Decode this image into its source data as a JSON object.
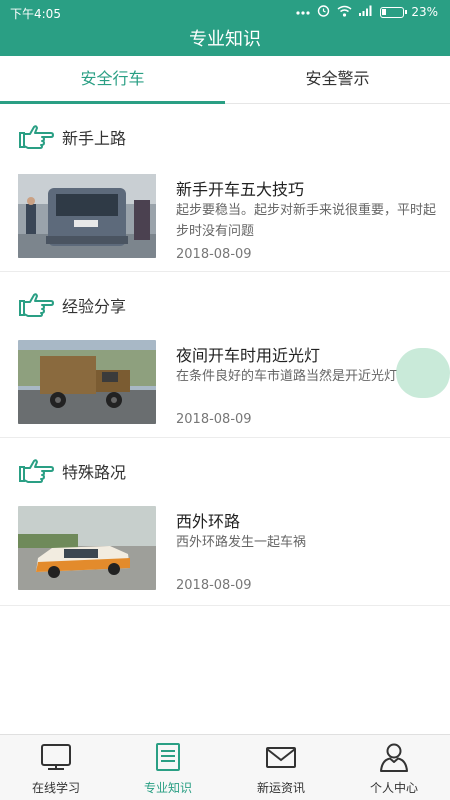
{
  "status_bar": {
    "time": "下午4:05",
    "battery": "23%"
  },
  "header": {
    "title": "专业知识"
  },
  "tabs": [
    {
      "label": "安全行车",
      "active": true
    },
    {
      "label": "安全警示",
      "active": false
    }
  ],
  "sections": [
    {
      "heading": "新手上路",
      "item": {
        "title": "新手开车五大技巧",
        "desc": "起步要稳当。起步对新手来说很重要，平时起步时没有问题",
        "date": "2018-08-09"
      }
    },
    {
      "heading": "经验分享",
      "item": {
        "title": "夜间开车时用近光灯",
        "desc": "在条件良好的车市道路当然是开近光灯",
        "date": "2018-08-09"
      }
    },
    {
      "heading": "特殊路况",
      "item": {
        "title": "西外环路",
        "desc": "西外环路发生一起车祸",
        "date": "2018-08-09"
      }
    }
  ],
  "bottom_nav": [
    {
      "label": "在线学习",
      "icon": "monitor-icon"
    },
    {
      "label": "专业知识",
      "icon": "document-icon",
      "active": true
    },
    {
      "label": "新运资讯",
      "icon": "mail-icon"
    },
    {
      "label": "个人中心",
      "icon": "person-icon"
    }
  ],
  "colors": {
    "accent": "#2a9f84",
    "text": "#333333",
    "muted": "#666666"
  }
}
